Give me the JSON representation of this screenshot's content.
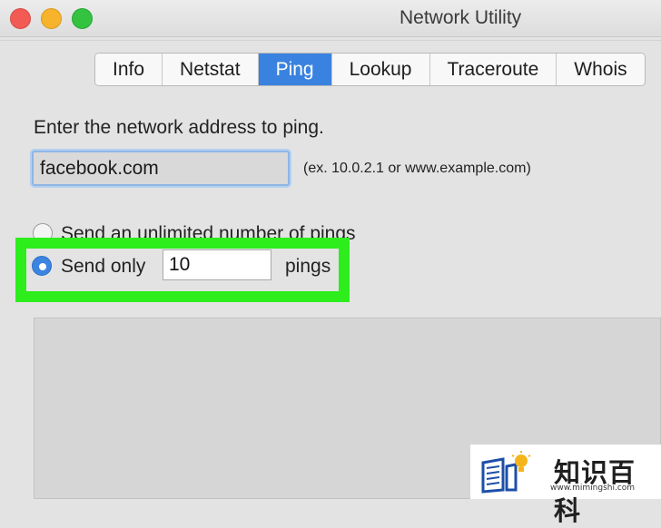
{
  "window": {
    "title": "Network Utility"
  },
  "tabs": [
    {
      "label": "Info",
      "active": false
    },
    {
      "label": "Netstat",
      "active": false
    },
    {
      "label": "Ping",
      "active": true
    },
    {
      "label": "Lookup",
      "active": false
    },
    {
      "label": "Traceroute",
      "active": false
    },
    {
      "label": "Whois",
      "active": false
    }
  ],
  "ping": {
    "prompt": "Enter the network address to ping.",
    "address_value": "facebook.com",
    "example_hint": "(ex. 10.0.2.1 or www.example.com)",
    "unlimited_label": "Send an unlimited number of pings",
    "send_only_label": "Send only",
    "count_value": "10",
    "pings_label": "pings"
  },
  "colors": {
    "accent": "#3a82e0",
    "highlight": "#2ded1d"
  },
  "watermark": {
    "brand": "知识百科",
    "url": "www.mimingshi.com"
  }
}
